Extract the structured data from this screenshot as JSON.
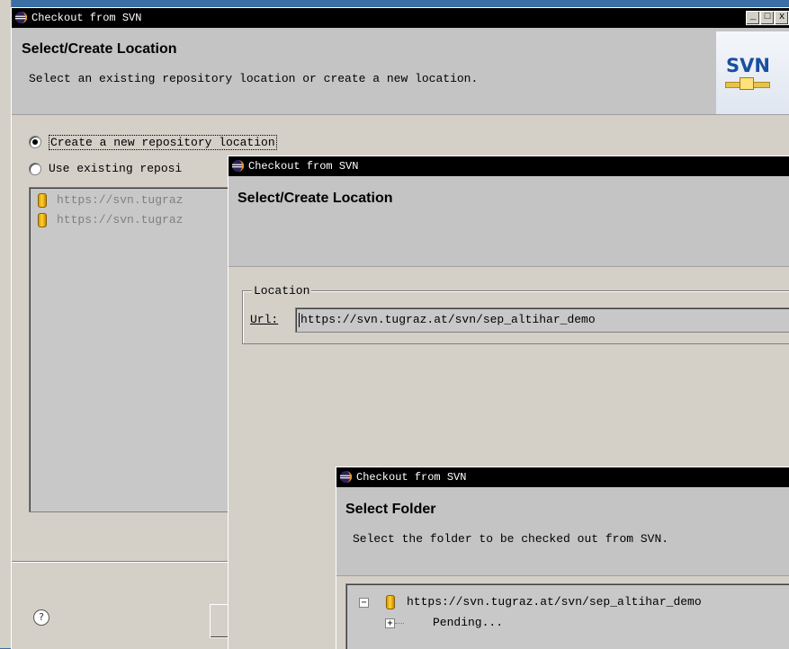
{
  "window1": {
    "title": "Checkout from SVN",
    "header_title": "Select/Create Location",
    "header_desc": "Select an existing repository location or create a new location.",
    "radio_create_label": "Create a new repository location",
    "radio_existing_label": "Use existing reposi",
    "repositories": [
      {
        "url": "https://svn.tugraz"
      },
      {
        "url": "https://svn.tugraz"
      }
    ],
    "logo_text": "SVN",
    "help_icon_glyph": "?",
    "window_buttons": {
      "minimize": "_",
      "maximize": "□",
      "close": "x"
    }
  },
  "window2": {
    "title": "Checkout from SVN",
    "header_title": "Select/Create Location",
    "location_group_label": "Location",
    "url_label": "Url:",
    "url_value": "https://svn.tugraz.at/svn/sep_altihar_demo"
  },
  "window3": {
    "title": "Checkout from SVN",
    "header_title": "Select Folder",
    "header_desc": "Select the folder to be checked out from SVN.",
    "tree_root": "https://svn.tugraz.at/svn/sep_altihar_demo",
    "tree_child": "Pending...",
    "expander_collapse": "−",
    "expander_expand": "+"
  },
  "colors": {
    "title_bar": "#000000",
    "dialog_bg": "#d4d0c8",
    "header_bg": "#c4c4c4",
    "svn_logo_blue": "#1a4fa0"
  }
}
